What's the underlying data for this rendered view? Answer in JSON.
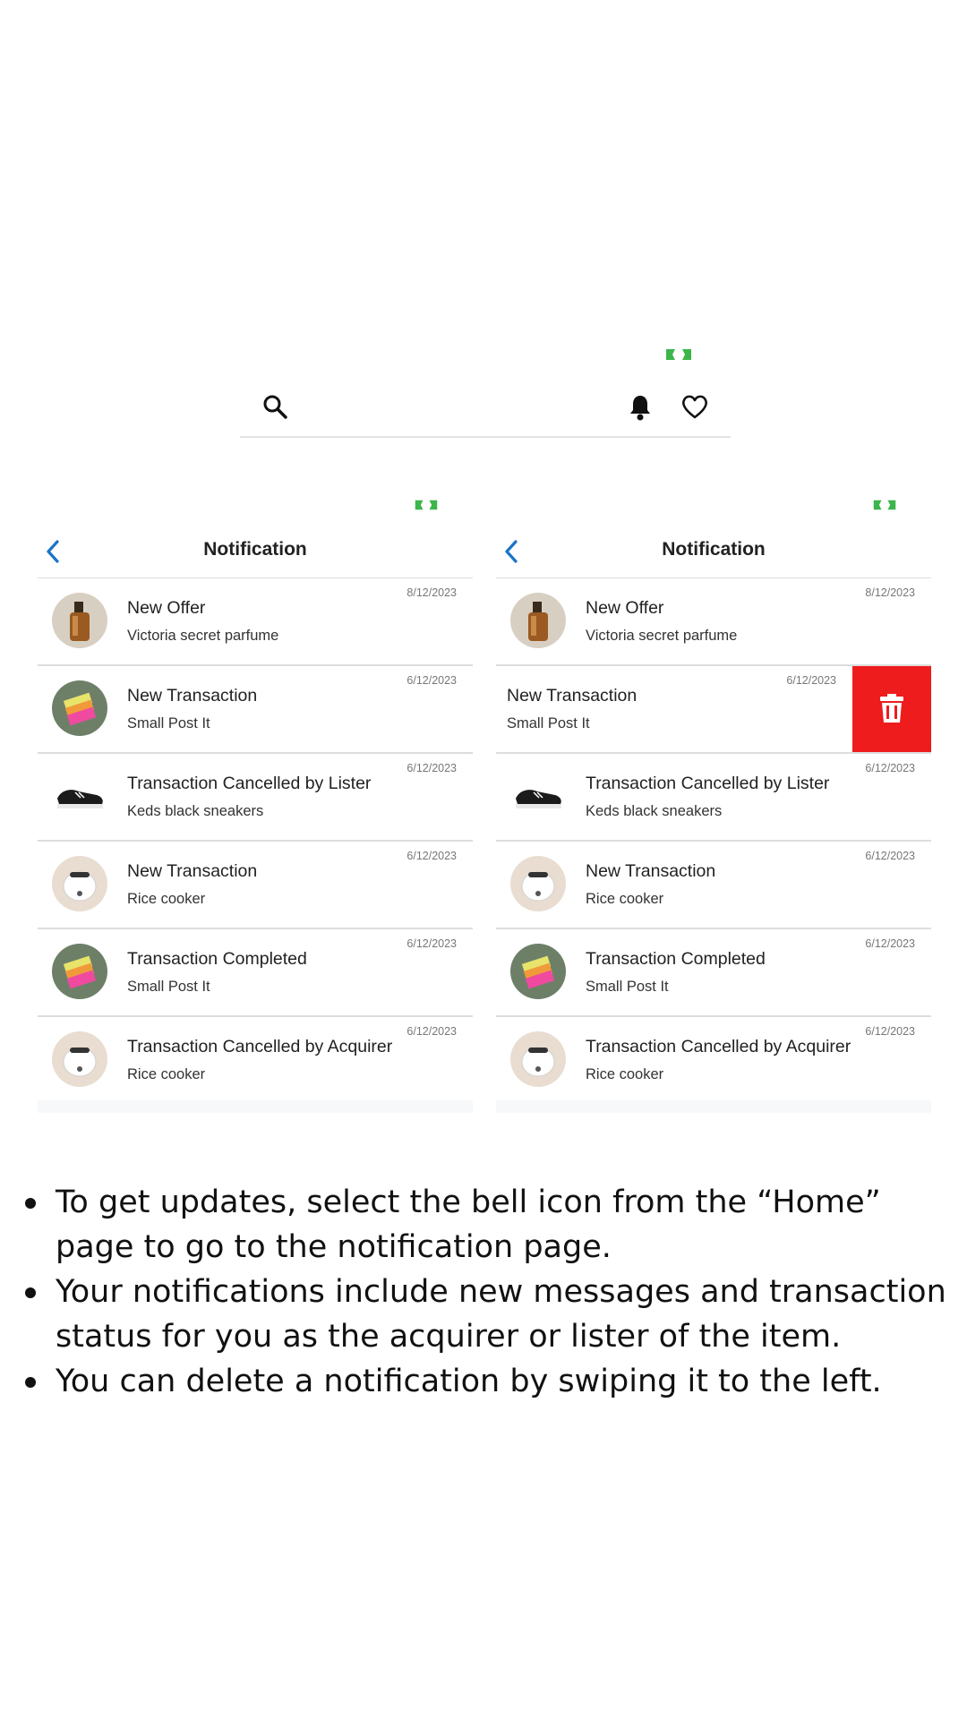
{
  "home_bar": {
    "icons": [
      "search-icon",
      "bell-icon",
      "heart-icon"
    ]
  },
  "colors": {
    "accent_blue": "#1a73c8",
    "delete_red": "#ee1c1c",
    "status_green": "#3cb54a"
  },
  "screens": [
    {
      "title": "Notification",
      "notifications": [
        {
          "title": "New Offer",
          "subtitle": "Victoria secret parfume",
          "date": "8/12/2023",
          "thumb": "perfume"
        },
        {
          "title": "New Transaction",
          "subtitle": "Small Post It",
          "date": "6/12/2023",
          "thumb": "postit"
        },
        {
          "title": "Transaction Cancelled by Lister",
          "subtitle": "Keds black sneakers",
          "date": "6/12/2023",
          "thumb": "sneaker"
        },
        {
          "title": "New Transaction",
          "subtitle": "Rice cooker",
          "date": "6/12/2023",
          "thumb": "cooker"
        },
        {
          "title": "Transaction Completed",
          "subtitle": "Small Post It",
          "date": "6/12/2023",
          "thumb": "postit"
        },
        {
          "title": "Transaction Cancelled by Acquirer",
          "subtitle": "Rice cooker",
          "date": "6/12/2023",
          "thumb": "cooker"
        }
      ]
    },
    {
      "title": "Notification",
      "notifications": [
        {
          "title": "New Offer",
          "subtitle": "Victoria secret parfume",
          "date": "8/12/2023",
          "thumb": "perfume"
        },
        {
          "title": "New Transaction",
          "subtitle": "Small Post It",
          "date": "6/12/2023",
          "thumb": "postit",
          "swiped": true,
          "action_icon": "trash-icon"
        },
        {
          "title": "Transaction Cancelled by Lister",
          "subtitle": "Keds black sneakers",
          "date": "6/12/2023",
          "thumb": "sneaker"
        },
        {
          "title": "New Transaction",
          "subtitle": "Rice cooker",
          "date": "6/12/2023",
          "thumb": "cooker"
        },
        {
          "title": "Transaction Completed",
          "subtitle": "Small Post It",
          "date": "6/12/2023",
          "thumb": "postit"
        },
        {
          "title": "Transaction Cancelled by Acquirer",
          "subtitle": "Rice cooker",
          "date": "6/12/2023",
          "thumb": "cooker"
        }
      ]
    }
  ],
  "instructions": [
    "To get updates, select the bell icon from the “Home” page to go to the notification page.",
    "Your notifications include new messages and transaction status for you as the acquirer or lister of the item.",
    "You can delete a notification by swiping it to the left."
  ]
}
